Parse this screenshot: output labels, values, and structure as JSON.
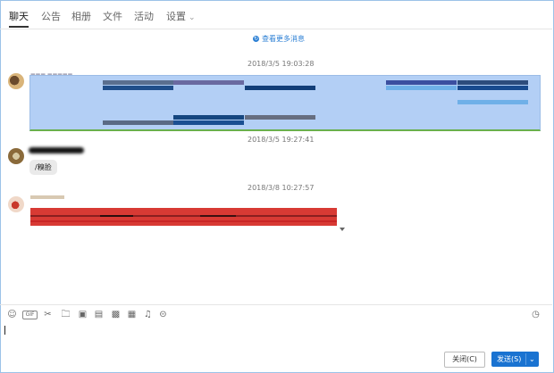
{
  "tabs": [
    {
      "label": "聊天",
      "active": true
    },
    {
      "label": "公告"
    },
    {
      "label": "相册"
    },
    {
      "label": "文件"
    },
    {
      "label": "活动"
    },
    {
      "label": "设置"
    }
  ],
  "history": {
    "load_more": "查看更多消息",
    "messages": [
      {
        "timestamp": "2018/3/5 19:03:28"
      },
      {
        "timestamp": "2018/3/5 19:27:41",
        "text": "/糗脸"
      },
      {
        "timestamp": "2018/3/8 10:27:57"
      }
    ]
  },
  "toolbar": {
    "icons": [
      "emoji-icon",
      "gif-icon",
      "scissors-icon",
      "folder-icon",
      "image-icon",
      "shop-icon",
      "gift-icon",
      "calendar-icon",
      "bell-icon",
      "more-icon"
    ],
    "gif_label": "GIF",
    "history_icon": "clock-icon"
  },
  "buttons": {
    "close": "关闭(C)",
    "send": "发送(S)",
    "send_dropdown": "⌄"
  }
}
